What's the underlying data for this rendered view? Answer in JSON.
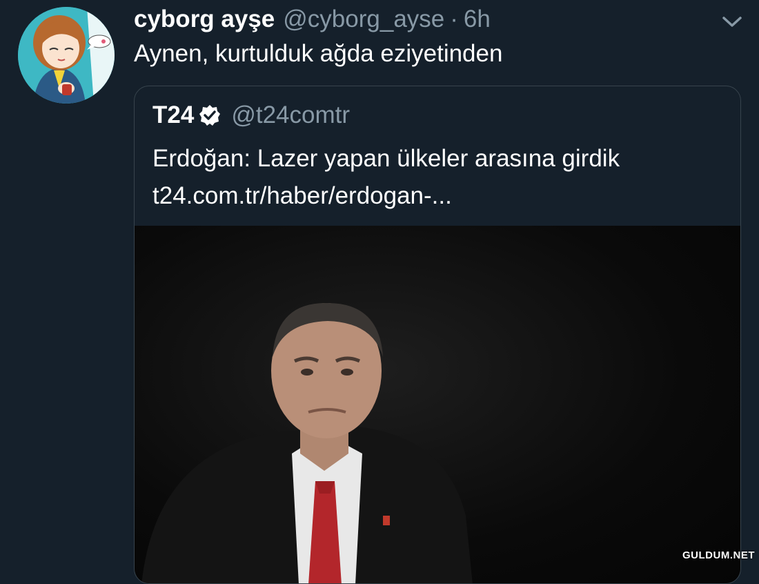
{
  "tweet": {
    "display_name": "cyborg ayşe",
    "handle": "@cyborg_ayse",
    "separator": "·",
    "time": "6h",
    "text": "Aynen, kurtulduk ağda eziyetinden"
  },
  "quoted_tweet": {
    "display_name": "T24",
    "handle": "@t24comtr",
    "text_line1": "Erdoğan: Lazer yapan ülkeler arasına girdik",
    "text_line2": "t24.com.tr/haber/erdogan-..."
  },
  "watermark": "GULDUM.NET",
  "icons": {
    "avatar": "cartoon-girl-avatar",
    "verified": "verified-badge-icon",
    "menu": "chevron-down-icon"
  },
  "colors": {
    "background": "#15202b",
    "secondary_text": "#8899a6",
    "border": "#38444d"
  }
}
